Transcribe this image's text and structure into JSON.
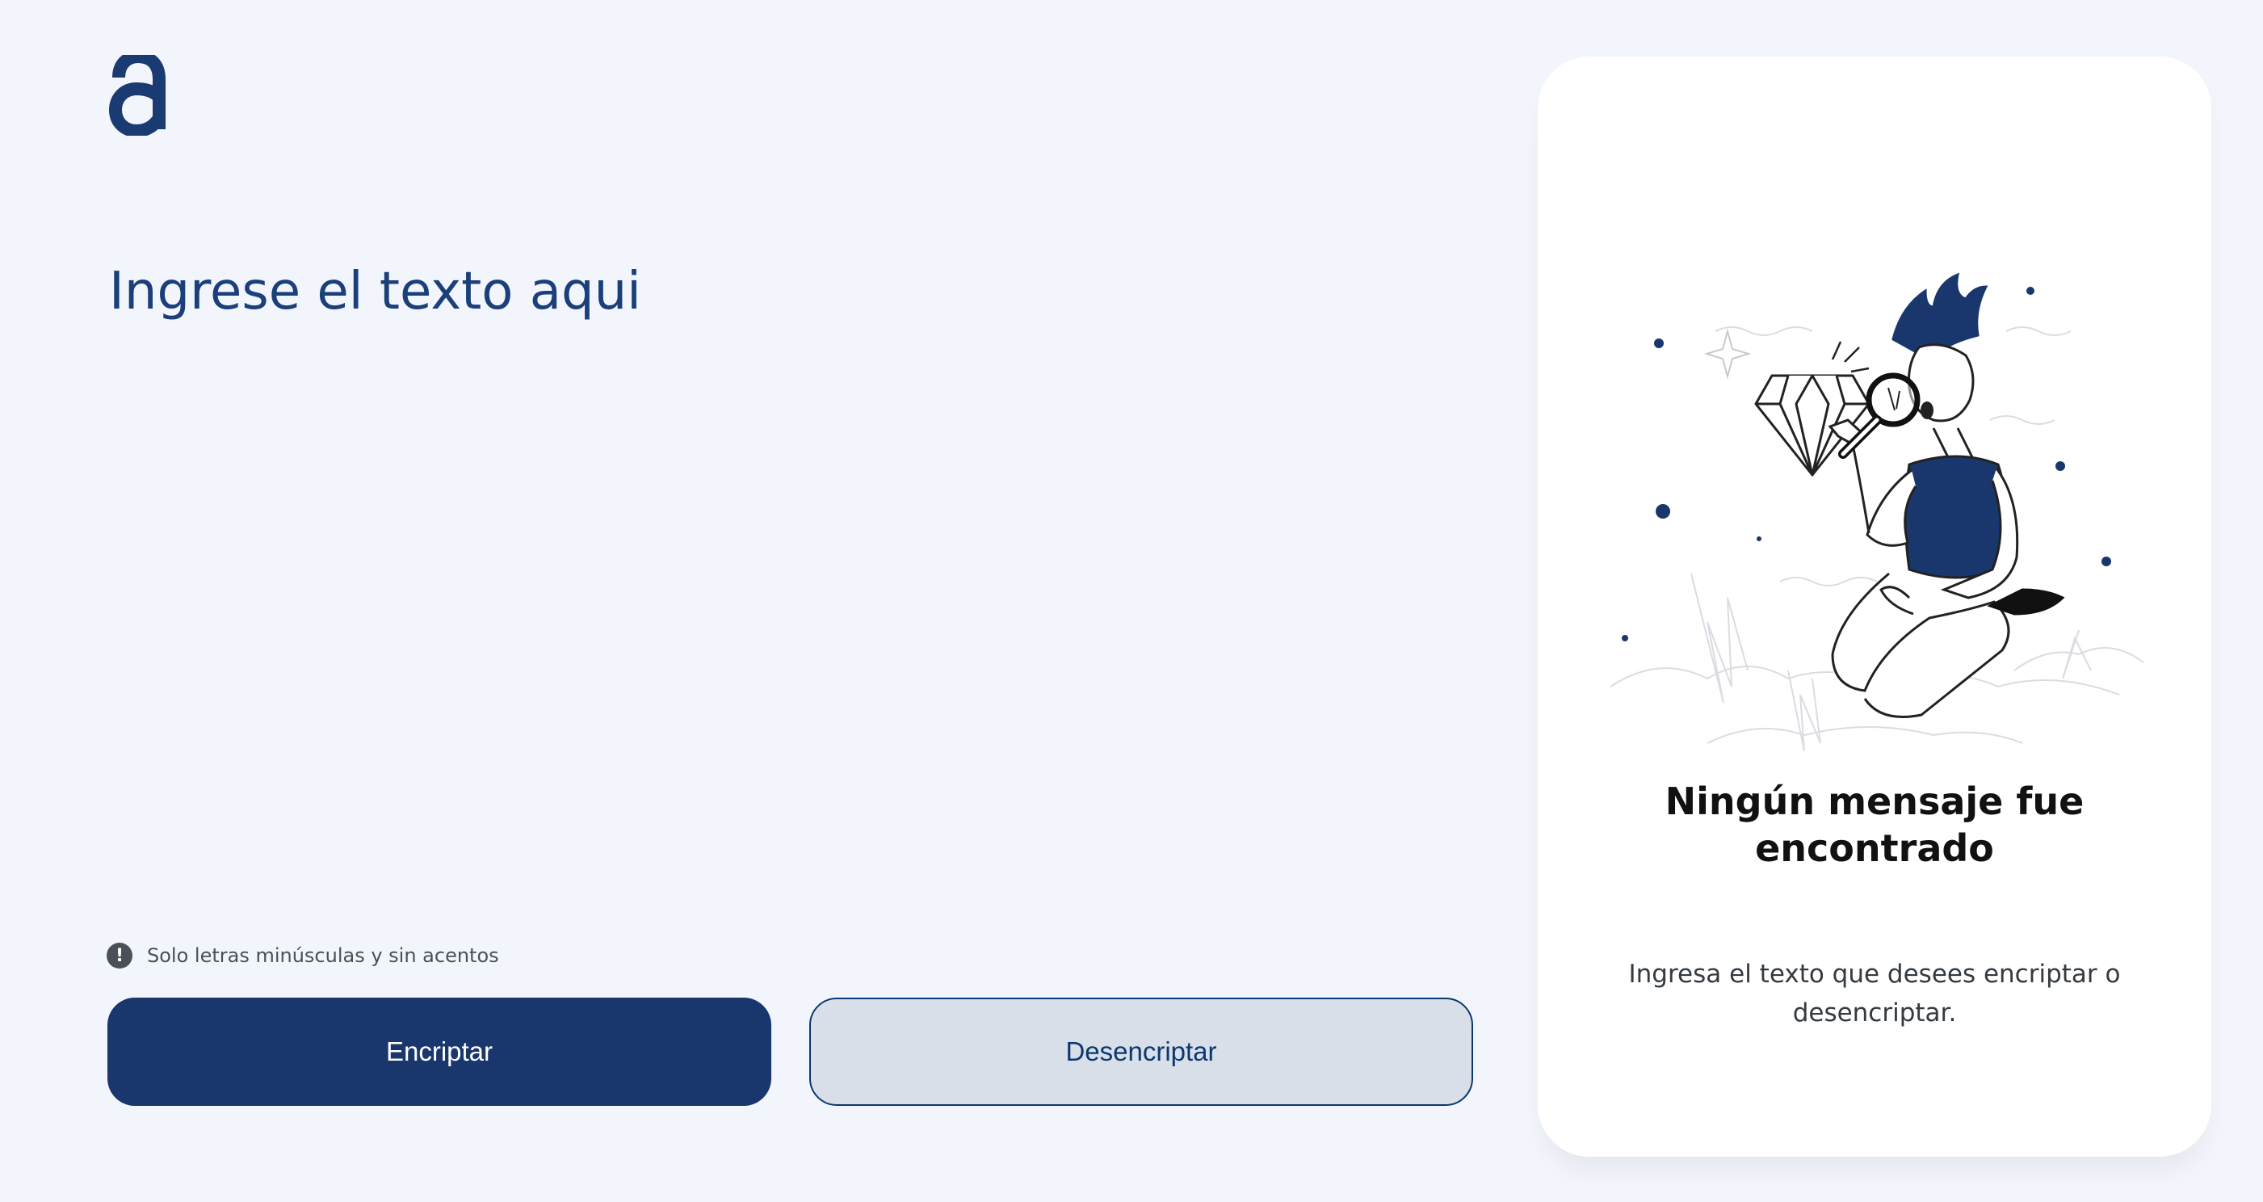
{
  "app": {
    "logo_icon": "letter-a-logo-icon",
    "brand_color": "#0a3871"
  },
  "input": {
    "placeholder": "Ingrese el texto aqui",
    "value": ""
  },
  "hint": {
    "icon": "exclamation-circle-icon",
    "text": "Solo letras minúsculas y sin acentos"
  },
  "buttons": {
    "encrypt_label": "Encriptar",
    "decrypt_label": "Desencriptar"
  },
  "output_panel": {
    "illustration": "person-with-magnifying-glass-illustration",
    "title": "Ningún mensaje fue encontrado",
    "message": "Ingresa el texto que desees encriptar o desencriptar."
  }
}
